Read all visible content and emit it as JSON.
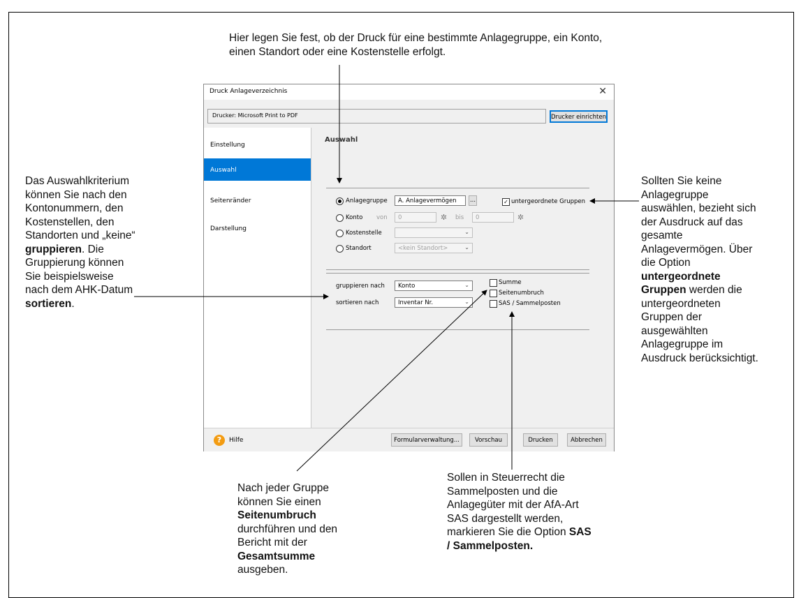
{
  "annotations": {
    "top": "Hier legen Sie fest, ob der Druck für eine bestimmte Anlagegruppe, ein Konto, einen Standort oder eine Kostenstelle erfolgt.",
    "left": {
      "part1": "Das Auswahlkriterium können Sie nach den Kontonummern, den Kostenstellen, den Standorten und „keine“ ",
      "bold1": "gruppieren",
      "part2": ". Die Gruppierung können Sie beispielsweise nach dem AHK-Datum ",
      "bold2": "sortieren",
      "part3": "."
    },
    "right": {
      "part1": "Sollten Sie keine Anlagegruppe auswählen, bezieht sich der Ausdruck auf das gesamte Anlagevermögen. Über die Option ",
      "bold1": "untergeordnete Gruppen",
      "part2": " werden die untergeordneten Gruppen der ausgewählten Anlagegruppe im Ausdruck berücksichtigt."
    },
    "bottom_left": {
      "part1": "Nach jeder Gruppe können Sie einen ",
      "bold1": "Seitenumbruch",
      "part2": " durchführen und den Bericht mit der ",
      "bold2": "Gesamtsumme",
      "part3": " ausgeben."
    },
    "bottom_right": {
      "part1": "Sollen in Steuerrecht die Sammelposten und die Anlagegüter mit der AfA-Art SAS dargestellt werden, markieren Sie die Option ",
      "bold1": "SAS / Sammelposten."
    }
  },
  "dialog": {
    "title": "Druck Anlageverzeichnis",
    "close_glyph": "✕",
    "printer_label": "Drucker:   Microsoft Print to PDF",
    "printer_setup_button": "Drucker einrichten",
    "nav": [
      "Einstellung",
      "Auswahl",
      "Seitenränder",
      "Darstellung"
    ],
    "active_nav": "Auswahl",
    "section_title": "Auswahl",
    "selection": {
      "anlagegruppe_label": "Anlagegruppe",
      "anlagegruppe_value": "A. Anlagevermögen",
      "browse_glyph": "...",
      "untergeordnete_label": "untergeordnete Gruppen",
      "untergeordnete_checked": true,
      "konto_label": "Konto",
      "von_label": "von",
      "von_value": "0",
      "bis_label": "bis",
      "bis_value": "0",
      "kostenstelle_label": "Kostenstelle",
      "kostenstelle_value": "",
      "standort_label": "Standort",
      "standort_value": "<kein Standort>",
      "selected_radio": "Anlagegruppe"
    },
    "grouping": {
      "gruppieren_label": "gruppieren nach",
      "gruppieren_value": "Konto",
      "sortieren_label": "sortieren nach",
      "sortieren_value": "Inventar Nr.",
      "summe_label": "Summe",
      "seitenumbruch_label": "Seitenumbruch",
      "sas_label": "SAS / Sammelposten"
    },
    "footer": {
      "help_icon": "?",
      "help_label": "Hilfe",
      "formular_button": "Formularverwaltung...",
      "vorschau_button": "Vorschau",
      "drucken_button": "Drucken",
      "abbrechen_button": "Abbrechen"
    }
  },
  "icons": {
    "gear": "✲",
    "check": "✓",
    "caret": "⌄"
  }
}
